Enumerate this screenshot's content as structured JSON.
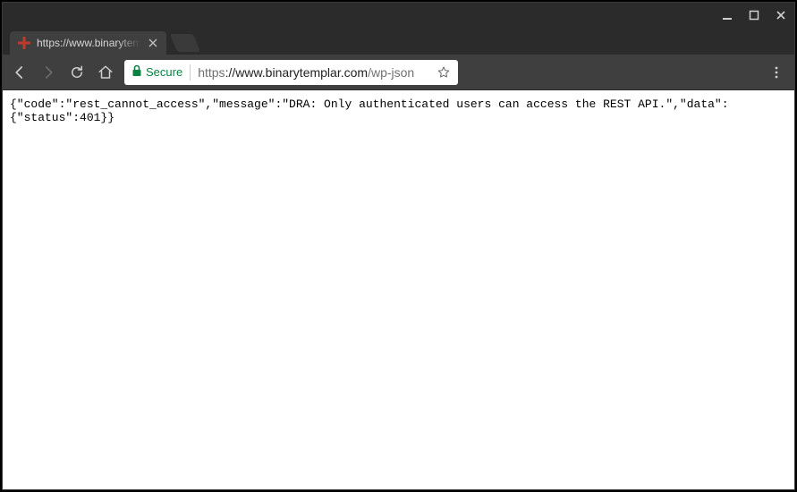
{
  "window_controls": {
    "minimize": "minimize",
    "maximize": "maximize",
    "close": "close"
  },
  "tab": {
    "title": "https://www.binarytempl",
    "favicon": "cross-red"
  },
  "toolbar": {
    "back_enabled": true,
    "forward_enabled": false,
    "secure_label": "Secure",
    "url_scheme": "https",
    "url_host": "://www.binarytemplar.com",
    "url_path": "/wp-json"
  },
  "page": {
    "body": "{\"code\":\"rest_cannot_access\",\"message\":\"DRA: Only authenticated users can access the REST API.\",\"data\":{\"status\":401}}"
  }
}
